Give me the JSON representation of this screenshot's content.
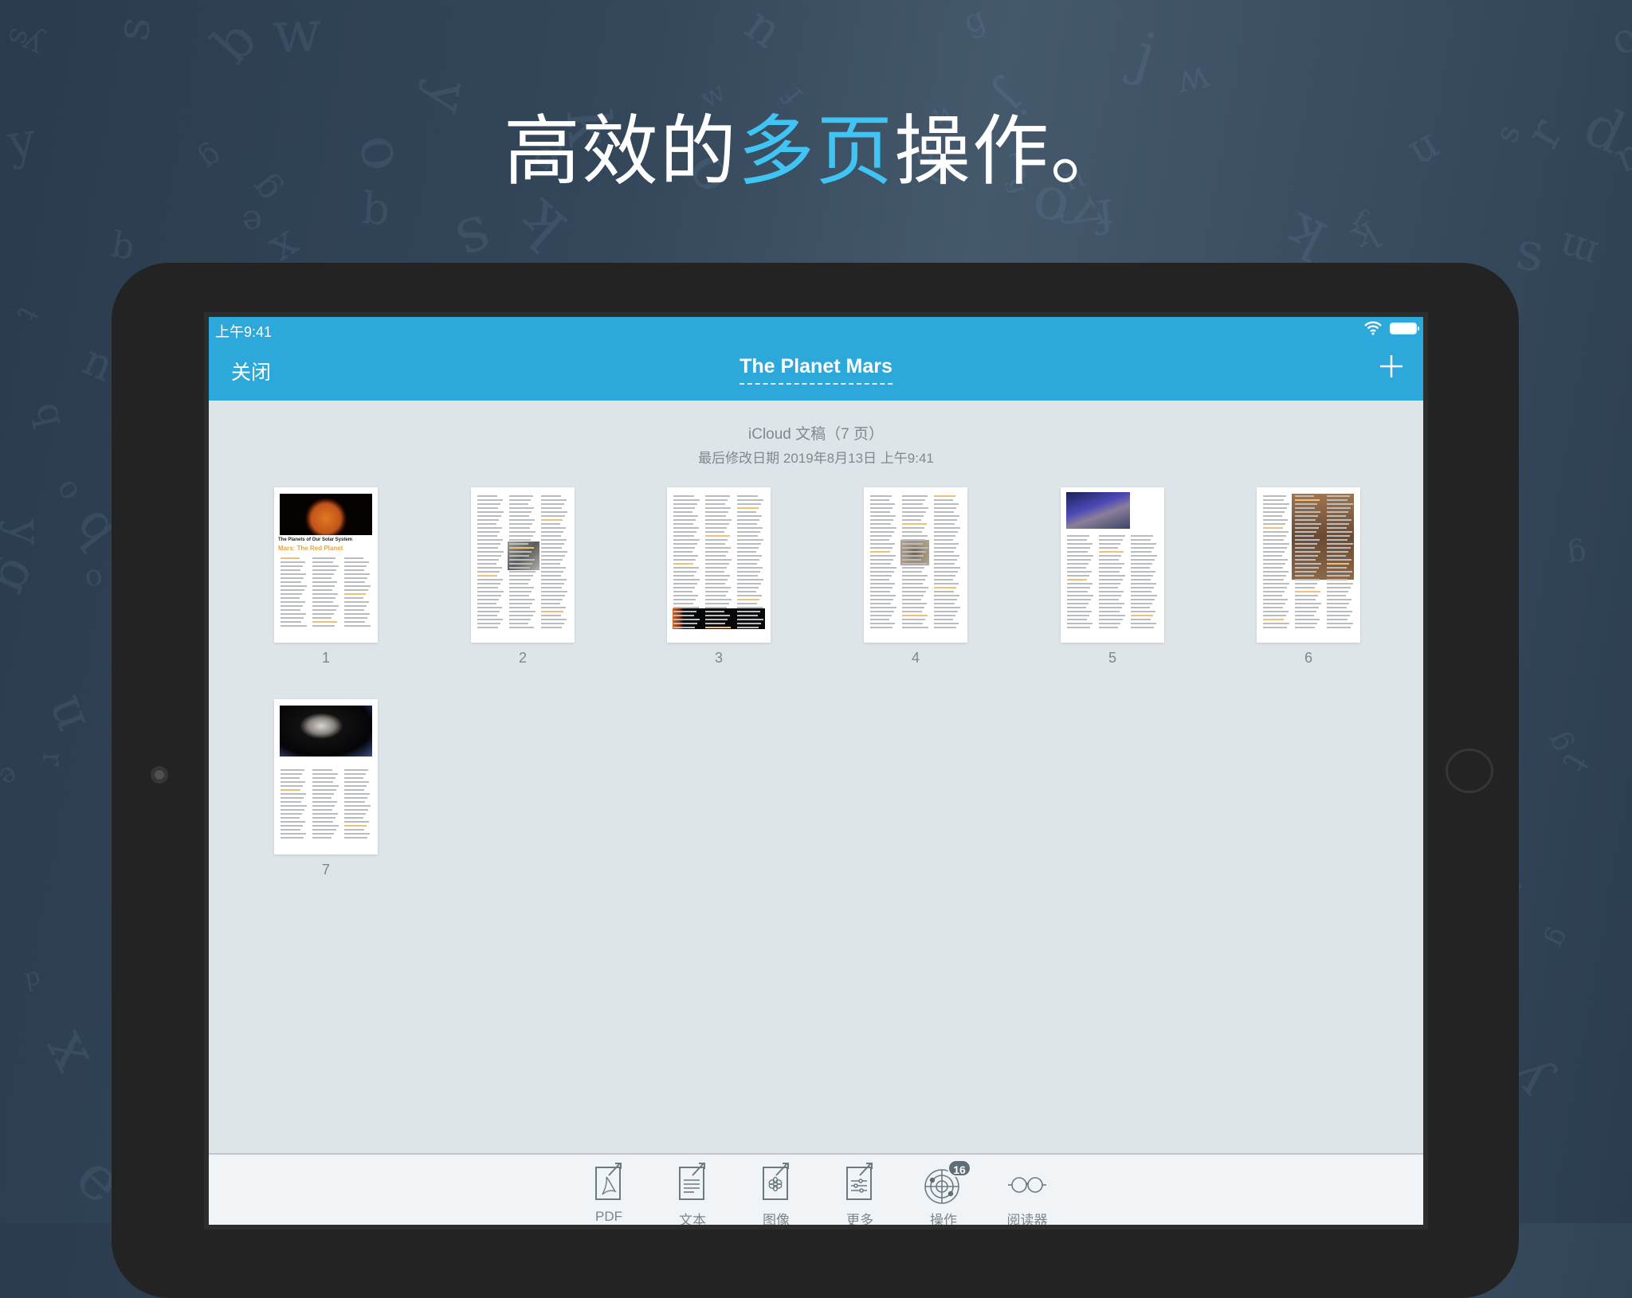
{
  "headline": {
    "before": "高效的",
    "accent": "多页",
    "after": "操作。",
    "accent_color": "#3fc4f3"
  },
  "status_bar": {
    "time": "上午9:41",
    "wifi_icon": "wifi-icon",
    "battery_icon": "battery-icon"
  },
  "nav_bar": {
    "close_label": "关闭",
    "title": "The Planet Mars",
    "add_icon": "plus-icon",
    "color": "#2ca8db"
  },
  "document_info": {
    "title": "iCloud 文稿（7 页）",
    "modified": "最后修改日期 2019年8月13日 上午9:41"
  },
  "pages": [
    {
      "number": "1",
      "heading": "The Planets of Our Solar System",
      "subheading": "Mars: The Red Planet",
      "image": "mars-planet"
    },
    {
      "number": "2",
      "image": "mars-surface-rock"
    },
    {
      "number": "3",
      "image": "solar-system-planets"
    },
    {
      "number": "4",
      "image": "mars-crater"
    },
    {
      "number": "5",
      "image": "mars-terrain-blue"
    },
    {
      "number": "6",
      "image": "mars-rover"
    },
    {
      "number": "7",
      "image": "spacecraft-over-planet"
    }
  ],
  "toolbar": {
    "items": [
      {
        "label": "PDF",
        "icon": "pdf-export-icon"
      },
      {
        "label": "文本",
        "icon": "text-export-icon"
      },
      {
        "label": "图像",
        "icon": "image-export-icon"
      },
      {
        "label": "更多",
        "icon": "more-export-icon"
      },
      {
        "label": "操作",
        "icon": "actions-radar-icon",
        "badge": "16"
      },
      {
        "label": "阅读器",
        "icon": "reader-glasses-icon"
      }
    ]
  }
}
